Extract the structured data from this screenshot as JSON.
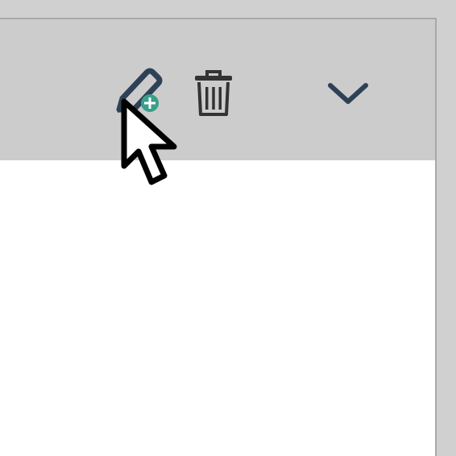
{
  "panel": {
    "header": {
      "actions": [
        {
          "name": "add-note",
          "icon": "pencil-plus-icon"
        },
        {
          "name": "delete",
          "icon": "trash-icon"
        },
        {
          "name": "collapse",
          "icon": "chevron-down-icon"
        }
      ]
    },
    "body": {}
  },
  "colors": {
    "background": "#d0d0d0",
    "header": "#cccccc",
    "body": "#ffffff",
    "border": "#a8a8a8",
    "icon_dark": "#2e4156",
    "icon_trash": "#333333",
    "accent_plus": "#3a9e8a"
  },
  "cursor": {
    "icon": "arrow-pointer-cursor"
  }
}
